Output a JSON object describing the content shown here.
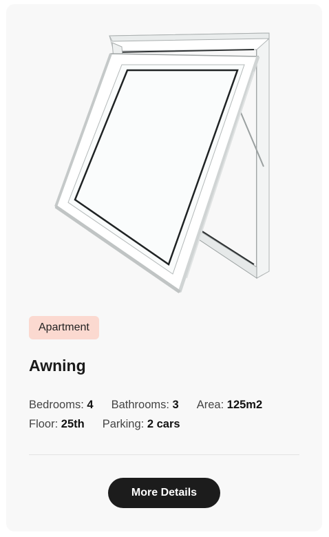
{
  "listing": {
    "image_alt": "awning window",
    "badge": "Apartment",
    "title": "Awning",
    "specs": {
      "bedrooms_label": "Bedrooms:",
      "bedrooms_value": "4",
      "bathrooms_label": "Bathrooms:",
      "bathrooms_value": "3",
      "area_label": "Area:",
      "area_value": "125m2",
      "floor_label": "Floor:",
      "floor_value": "25th",
      "parking_label": "Parking:",
      "parking_value": "2 cars"
    },
    "button_label": "More Details"
  },
  "colors": {
    "card_bg": "#f8f8f8",
    "badge_bg": "#fbd9d0",
    "button_bg": "#1c1c1c"
  }
}
